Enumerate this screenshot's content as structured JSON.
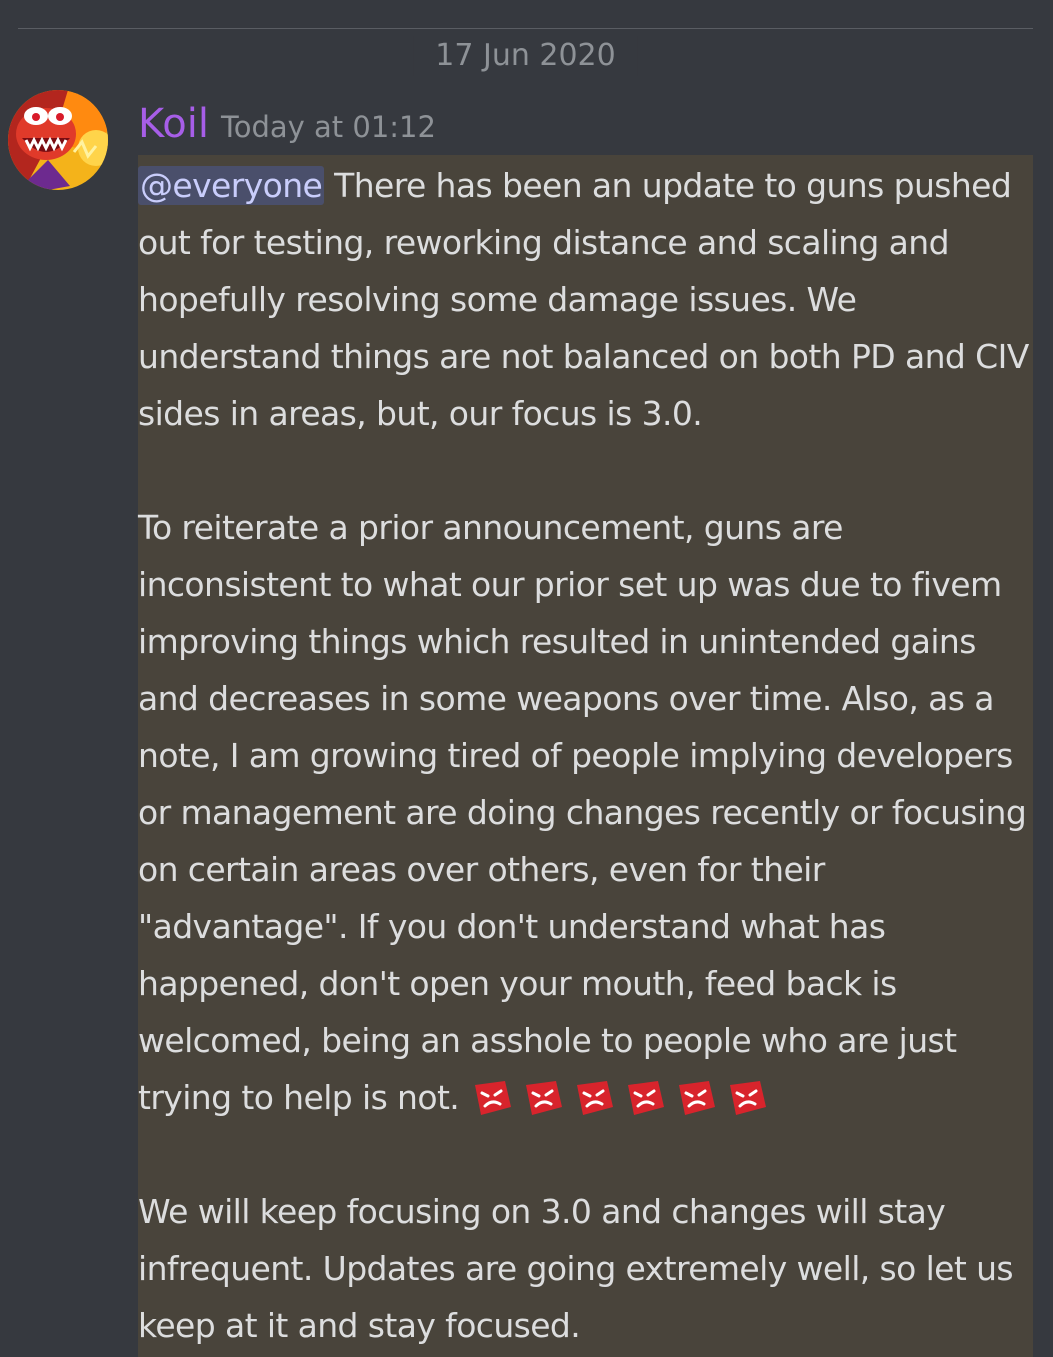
{
  "divider": {
    "date": "17 Jun 2020"
  },
  "message": {
    "author": "Koil",
    "timestamp": "Today at 01:12",
    "mention": "@everyone",
    "paragraph1": "There has been an update to guns pushed out for testing, reworking distance and scaling and hopefully resolving some damage issues. We understand things are not balanced on both PD and CIV sides in areas, but, our focus is 3.0.",
    "paragraph2": "To reiterate a prior announcement, guns are inconsistent to what our prior set up was due to fivem improving things which resulted in unintended gains and decreases in some weapons over time. Also, as a note, I am growing tired of people implying developers or management are doing changes recently or focusing on certain areas over others, even for their \"advantage\". If you don't understand what has happened, don't open your mouth, feed back is welcomed, being an asshole to people who are just trying to help is not.",
    "paragraph3": "We will keep focusing on 3.0 and changes will stay infrequent. Updates are going extremely well, so let us keep at it and stay focused.",
    "emojis": [
      "angry-emoji",
      "angry-emoji",
      "angry-emoji",
      "angry-emoji",
      "angry-emoji",
      "angry-emoji"
    ]
  },
  "colors": {
    "background": "#36393f",
    "highlight": "#49443b",
    "username": "#a75ee8",
    "mention": "#c9cdfb",
    "emoji": "#d8242c"
  }
}
